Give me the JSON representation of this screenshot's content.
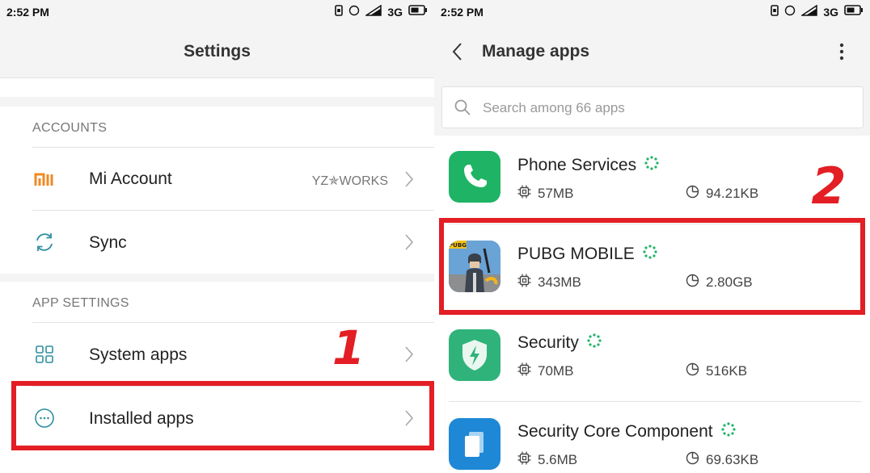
{
  "colors": {
    "accent_red": "#e31e24",
    "mi_orange": "#f08a24",
    "teal_icon": "#2e8fa0"
  },
  "left": {
    "status": {
      "time": "2:52 PM",
      "network": "3G"
    },
    "title": "Settings",
    "accounts_header": "ACCOUNTS",
    "app_settings_header": "APP SETTINGS",
    "items": {
      "mi_account": {
        "label": "Mi Account",
        "value": "YZ✯WORKS",
        "icon": "mi-logo-icon"
      },
      "sync": {
        "label": "Sync",
        "icon": "sync-icon"
      },
      "system_apps": {
        "label": "System apps",
        "icon": "grid-icon"
      },
      "installed_apps": {
        "label": "Installed apps",
        "icon": "more-dots-circle-icon"
      }
    },
    "annotation": "1"
  },
  "right": {
    "status": {
      "time": "2:52 PM",
      "network": "3G"
    },
    "title": "Manage apps",
    "search_placeholder": "Search among 66 apps",
    "apps": [
      {
        "name": "Phone Services",
        "size": "57MB",
        "cache": "94.21KB",
        "icon": "phone-icon"
      },
      {
        "name": "PUBG MOBILE",
        "size": "343MB",
        "cache": "2.80GB",
        "icon": "pubg-icon"
      },
      {
        "name": "Security",
        "size": "70MB",
        "cache": "516KB",
        "icon": "security-shield-icon"
      },
      {
        "name": "Security Core Component",
        "size": "5.6MB",
        "cache": "69.63KB",
        "icon": "security-core-icon"
      }
    ],
    "pubg_badge": "PUBG",
    "annotation": "2"
  }
}
